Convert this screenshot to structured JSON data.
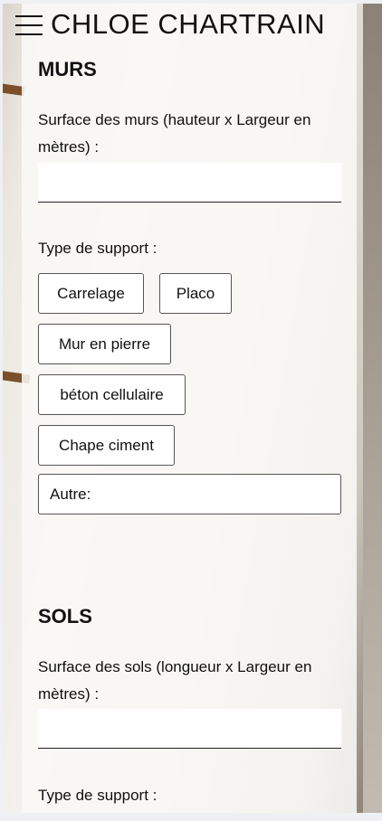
{
  "header": {
    "brand": "CHLOE CHARTRAIN"
  },
  "walls": {
    "title": "MURS",
    "surface_label": "Surface des murs (hauteur x Largeur en mètres) :",
    "surface_value": "",
    "support_label": "Type de support :",
    "supports": [
      "Carrelage",
      "Placo",
      "Mur en pierre",
      "béton cellulaire",
      "Chape ciment"
    ],
    "other_label": "Autre:"
  },
  "floors": {
    "title": "SOLS",
    "surface_label": "Surface des sols (longueur x Largeur en mètres) :",
    "surface_value": "",
    "support_label": "Type de support :"
  }
}
